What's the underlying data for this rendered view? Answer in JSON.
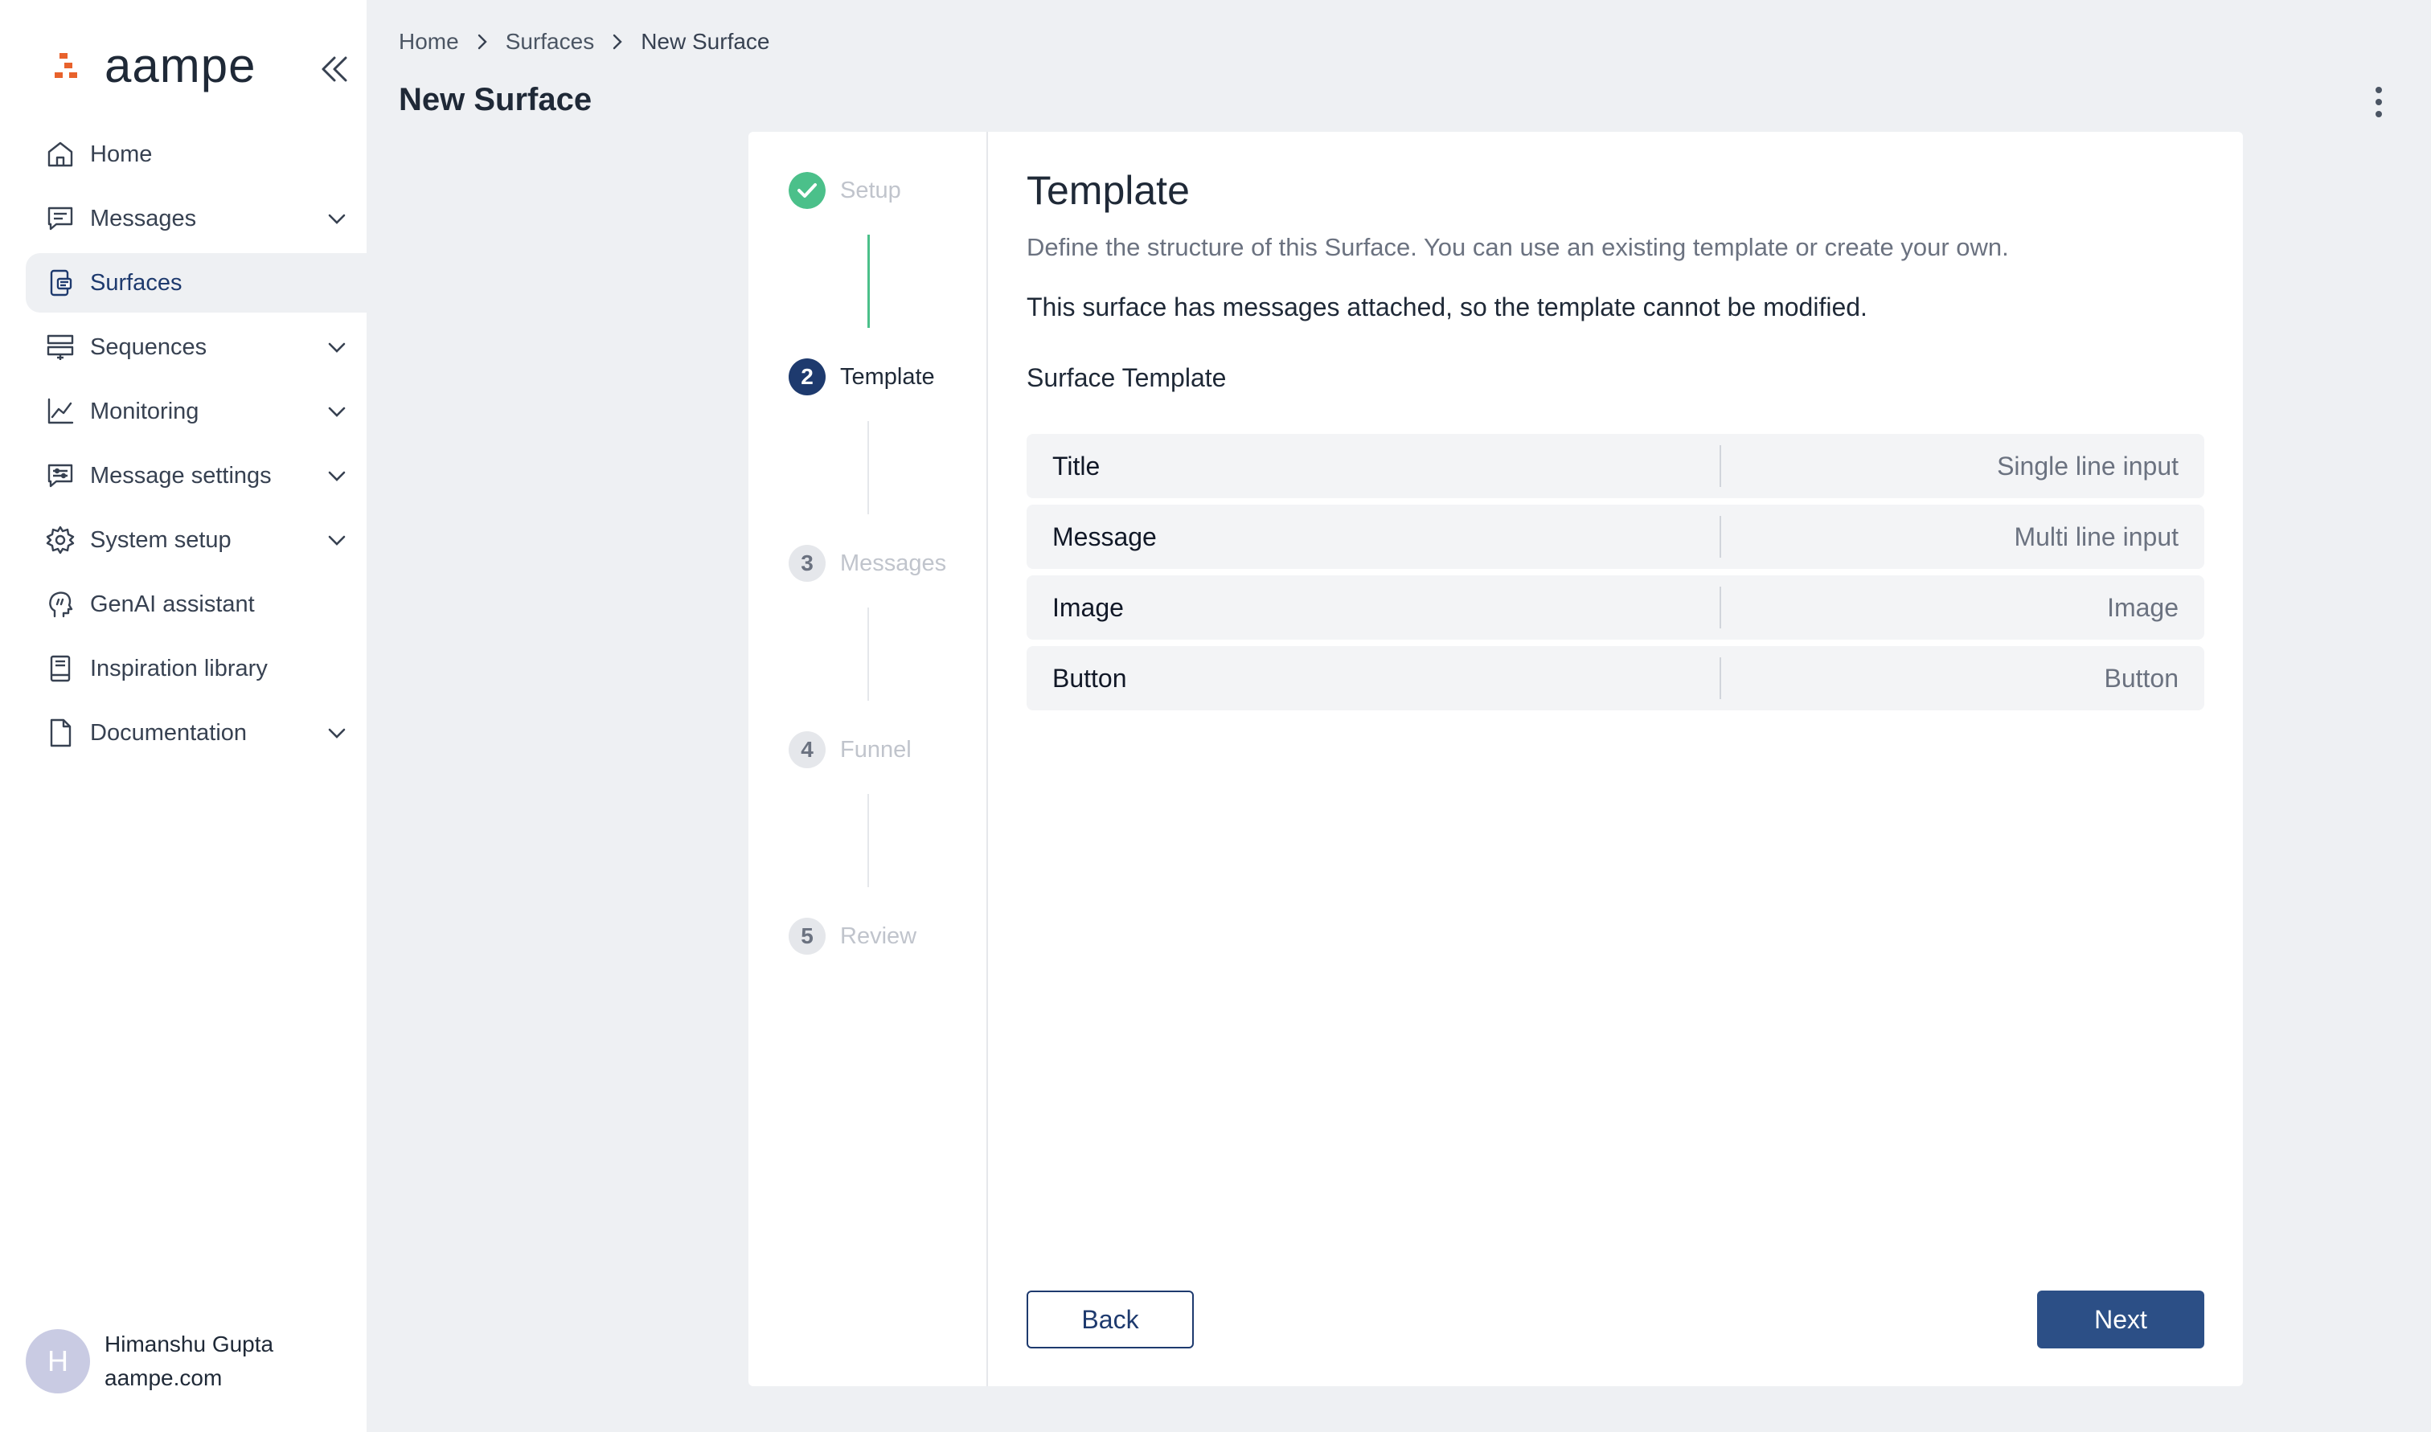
{
  "brand": {
    "name": "aampe"
  },
  "sidebar": {
    "items": [
      {
        "label": "Home"
      },
      {
        "label": "Messages"
      },
      {
        "label": "Surfaces"
      },
      {
        "label": "Sequences"
      },
      {
        "label": "Monitoring"
      },
      {
        "label": "Message settings"
      },
      {
        "label": "System setup"
      },
      {
        "label": "GenAI assistant"
      },
      {
        "label": "Inspiration library"
      },
      {
        "label": "Documentation"
      }
    ],
    "active": "Surfaces"
  },
  "user": {
    "initial": "H",
    "name": "Himanshu Gupta",
    "org": "aampe.com"
  },
  "breadcrumb": [
    "Home",
    "Surfaces",
    "New Surface"
  ],
  "page": {
    "title": "New Surface"
  },
  "stepper": {
    "steps": [
      {
        "number": "1",
        "label": "Setup",
        "state": "done"
      },
      {
        "number": "2",
        "label": "Template",
        "state": "current"
      },
      {
        "number": "3",
        "label": "Messages",
        "state": "todo"
      },
      {
        "number": "4",
        "label": "Funnel",
        "state": "todo"
      },
      {
        "number": "5",
        "label": "Review",
        "state": "todo"
      }
    ]
  },
  "content": {
    "title": "Template",
    "description": "Define the structure of this Surface. You can use an existing template or create your own.",
    "note": "This surface has messages attached, so the template cannot be modified.",
    "subheading": "Surface Template",
    "template_rows": [
      {
        "name": "Title",
        "type": "Single line input"
      },
      {
        "name": "Message",
        "type": "Multi line input"
      },
      {
        "name": "Image",
        "type": "Image"
      },
      {
        "name": "Button",
        "type": "Button"
      }
    ]
  },
  "actions": {
    "back_label": "Back",
    "next_label": "Next"
  },
  "colors": {
    "primary": "#2c4f86",
    "success": "#4bc08a",
    "brand_orange": "#e8622c"
  }
}
